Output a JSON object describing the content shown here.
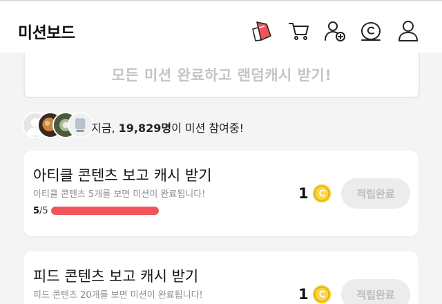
{
  "header": {
    "title": "미션보드",
    "icons": [
      "mission-ticket-icon",
      "cart-icon",
      "add-user-icon",
      "cash-coin-icon",
      "profile-icon"
    ]
  },
  "banner": {
    "text": "모든 미션 완료하고 랜덤캐시 받기!"
  },
  "participants": {
    "prefix": "지금, ",
    "count": "19,829명",
    "suffix": "이 미션 참여중!"
  },
  "missions": [
    {
      "title": "아티클 콘텐츠 보고 캐시 받기",
      "desc": "아티클 콘텐츠 5개를 보면 미션이 완료됩니다!",
      "progress_current": "5",
      "progress_total": "/5",
      "progress_fraction": 1.0,
      "reward": "1",
      "button": "적립완료"
    },
    {
      "title": "피드 콘텐츠 보고 캐시 받기",
      "desc": "피드 콘텐츠 20개를 보면 미션이 완료됩니다!",
      "reward": "1",
      "button": "적립완료"
    }
  ],
  "colors": {
    "accent": "#f0545a",
    "coin": "#f5c518",
    "disabled_button": "#ececec"
  }
}
